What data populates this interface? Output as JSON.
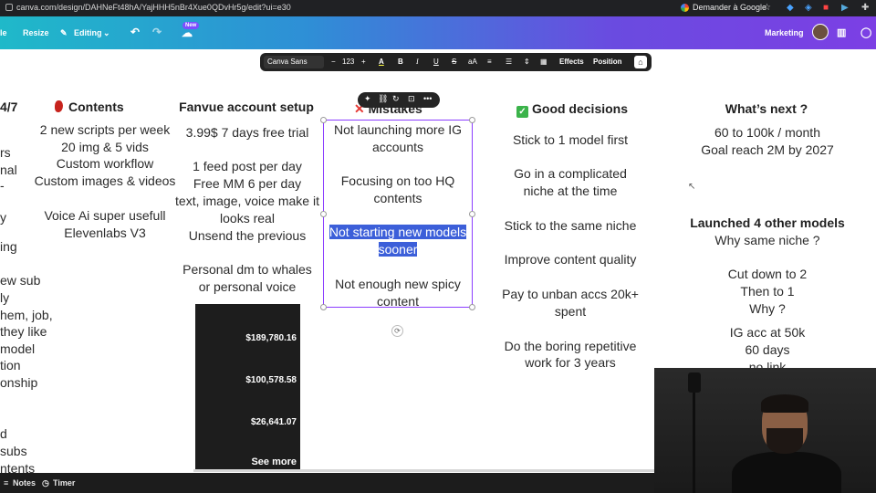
{
  "browser": {
    "url": "canva.com/design/DAHNeFt48hA/YajHHH5nBr4Xue0QDvHr5g/edit?ui=e30",
    "google_button": "Demander à Google"
  },
  "topbar": {
    "file": "le",
    "resize": "Resize",
    "editing": "Editing",
    "new_badge": "New",
    "marketing": "Marketing"
  },
  "text_toolbar": {
    "font": "Canva Sans",
    "minus": "−",
    "size": "123",
    "plus": "+",
    "color": "A",
    "bold": "B",
    "italic": "I",
    "underline": "U",
    "strike": "S",
    "case": "aA",
    "effects": "Effects",
    "position": "Position"
  },
  "col0": {
    "heading": "4/7",
    "lines": [
      "rs",
      "nal",
      "-",
      "y",
      "ing",
      "ew sub",
      "ly",
      "hem, job,",
      "they like",
      "model",
      "tion",
      "onship",
      "d",
      "subs",
      "ntents"
    ]
  },
  "contents": {
    "heading": "Contents",
    "lines": [
      "2 new scripts per week",
      "20 img & 5 vids",
      "Custom workflow",
      "Custom images & videos",
      "Voice Ai super usefull",
      "Elevenlabs V3"
    ]
  },
  "fanvue": {
    "heading": "Fanvue account setup",
    "lines": [
      "3.99$ 7 days free trial",
      "1 feed post per day",
      "Free MM 6 per day",
      "text, image, voice make it",
      "looks real",
      "Unsend the previous",
      "Personal dm to whales",
      "or personal voice"
    ],
    "amounts": [
      "$189,780.16",
      "$100,578.58",
      "$26,641.07"
    ],
    "see_more": "See more"
  },
  "mistakes": {
    "heading": "Mistakes",
    "lines": [
      "Not launching more IG",
      "accounts",
      "Focusing on too HQ",
      "contents",
      "Not starting new models",
      "sooner",
      "Not enough new spicy",
      "content"
    ]
  },
  "good": {
    "heading": "Good decisions",
    "lines": [
      "Stick to 1 model first",
      "Go in a complicated",
      "niche at the time",
      "Stick to the same niche",
      "Improve content quality",
      "Pay to unban accs 20k+",
      "spent",
      "Do the boring repetitive",
      "work for 3 years"
    ]
  },
  "next": {
    "heading": "What’s next ?",
    "lines": [
      "60 to 100k / month",
      "Goal reach 2M by 2027"
    ],
    "heading2": "Launched 4 other models",
    "lines2": [
      "Why same niche ?",
      "Cut down to 2",
      "Then to 1",
      "Why ?",
      "IG acc at 50k",
      "60 days",
      "no link"
    ]
  },
  "bottombar": {
    "notes": "Notes",
    "timer": "Timer"
  },
  "colors": {
    "selection": "#8b3dff",
    "highlight": "#3c5fd9",
    "check": "#3bb34a"
  }
}
